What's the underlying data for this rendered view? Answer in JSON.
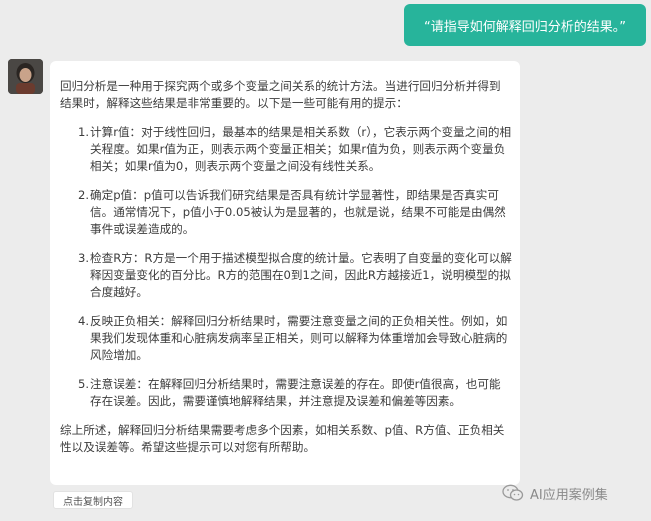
{
  "user_message": "“请指导如何解释回归分析的结果。”",
  "reply": {
    "intro": "回归分析是一种用于探究两个或多个变量之间关系的统计方法。当进行回归分析并得到结果时，解释这些结果是非常重要的。以下是一些可能有用的提示：",
    "tips": [
      {
        "num": "1.",
        "text": "计算r值：对于线性回归，最基本的结果是相关系数（r），它表示两个变量之间的相关程度。如果r值为正，则表示两个变量正相关；如果r值为负，则表示两个变量负相关；如果r值为0，则表示两个变量之间没有线性关系。"
      },
      {
        "num": "2.",
        "text": "确定p值：p值可以告诉我们研究结果是否具有统计学显著性，即结果是否真实可信。通常情况下，p值小于0.05被认为是显著的，也就是说，结果不可能是由偶然事件或误差造成的。"
      },
      {
        "num": "3.",
        "text": "检查R方：R方是一个用于描述模型拟合度的统计量。它表明了自变量的变化可以解释因变量变化的百分比。R方的范围在0到1之间，因此R方越接近1，说明模型的拟合度越好。"
      },
      {
        "num": "4.",
        "text": "反映正负相关：解释回归分析结果时，需要注意变量之间的正负相关性。例如，如果我们发现体重和心脏病发病率呈正相关，则可以解释为体重增加会导致心脏病的风险增加。"
      },
      {
        "num": "5.",
        "text": "注意误差：在解释回归分析结果时，需要注意误差的存在。即使r值很高，也可能存在误差。因此，需要谨慎地解释结果，并注意提及误差和偏差等因素。"
      }
    ],
    "conclusion": "综上所述，解释回归分析结果需要考虑多个因素，如相关系数、p值、R方值、正负相关性以及误差等。希望这些提示可以对您有所帮助。"
  },
  "copy_button": "点击复制内容",
  "watermark": "AI应用案例集",
  "colors": {
    "user_bubble": "#27b49b",
    "background": "#ececec"
  }
}
